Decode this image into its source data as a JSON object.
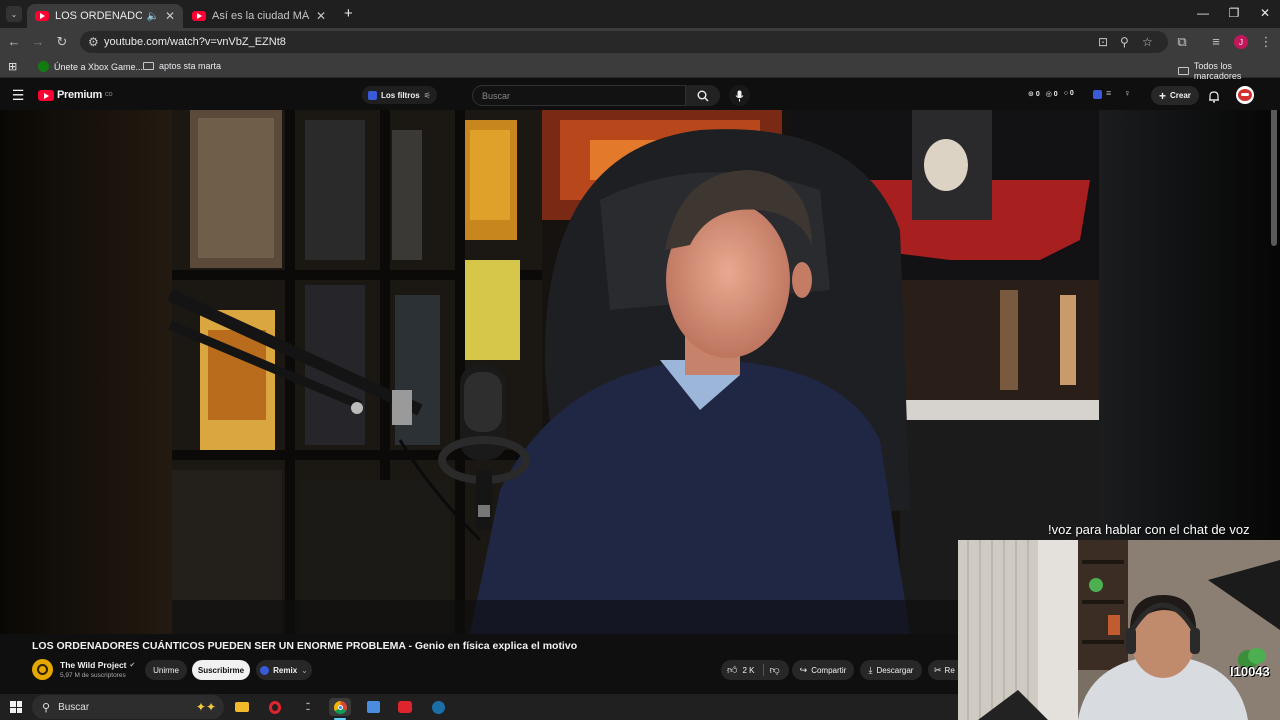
{
  "browser": {
    "tabs": [
      {
        "title": "LOS ORDENADORES CUÁNTICOS",
        "audio": true,
        "active": true
      },
      {
        "title": "Así es la ciudad MÁS RACISTA de",
        "audio": false,
        "active": false
      }
    ],
    "url": "youtube.com/watch?v=vnVbZ_EZNt8",
    "profile_initial": "J",
    "bookmarks": [
      {
        "label": "Únete a Xbox Game...",
        "icon": "xbox-icon"
      },
      {
        "label": "aptos sta marta",
        "icon": "folder-icon"
      }
    ],
    "all_bookmarks": "Todos los marcadores"
  },
  "youtube": {
    "logo_text": "Premium",
    "logo_sup": "CO",
    "filters_label": "Los filtros",
    "search_placeholder": "Buscar",
    "counters": [
      "0",
      "0",
      "0"
    ],
    "create_label": "Crear"
  },
  "video": {
    "title": "LOS ORDENADORES CUÁNTICOS PUEDEN SER UN ENORME PROBLEMA - Genio en física explica el motivo",
    "channel": "The Wild Project",
    "subscribers": "5,97 M de suscriptores",
    "join_label": "Unirme",
    "subscribe_label": "Suscribirme",
    "remix_label": "Remix",
    "likes": "2 K",
    "share_label": "Compartir",
    "download_label": "Descargar",
    "clip_label": "Re"
  },
  "overlay": {
    "voice_text": "!voz para hablar con el chat de voz",
    "badge_text": "I10043"
  },
  "taskbar": {
    "search_placeholder": "Buscar",
    "apps": [
      "file-explorer-icon",
      "opera-gx-icon",
      "league-icon",
      "chrome-icon",
      "store-icon",
      "media-icon",
      "steam-icon"
    ]
  },
  "colors": {
    "yt_red": "#ff0033",
    "bg": "#0f0f0f",
    "chrome_dark": "#3c3c3c"
  }
}
